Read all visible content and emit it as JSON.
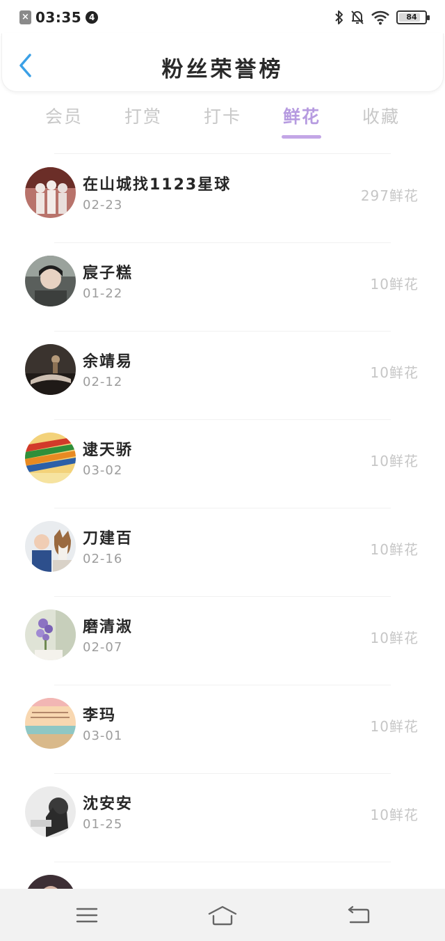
{
  "status_bar": {
    "time": "03:35",
    "notification_count": "4",
    "battery": "84",
    "battery_fraction": 0.84
  },
  "header": {
    "title": "粉丝荣誉榜"
  },
  "tabs": [
    {
      "label": "会员"
    },
    {
      "label": "打赏"
    },
    {
      "label": "打卡"
    },
    {
      "label": "鲜花"
    },
    {
      "label": "收藏"
    }
  ],
  "active_tab": "鲜花",
  "fans": [
    {
      "name": "在山城找1123星球",
      "date": "02-23",
      "count": "297鲜花"
    },
    {
      "name": "宸子糕",
      "date": "01-22",
      "count": "10鲜花"
    },
    {
      "name": "余靖易",
      "date": "02-12",
      "count": "10鲜花"
    },
    {
      "name": "逮天骄",
      "date": "03-02",
      "count": "10鲜花"
    },
    {
      "name": "刀建百",
      "date": "02-16",
      "count": "10鲜花"
    },
    {
      "name": "磨清淑",
      "date": "02-07",
      "count": "10鲜花"
    },
    {
      "name": "李玛",
      "date": "03-01",
      "count": "10鲜花"
    },
    {
      "name": "沈安安",
      "date": "01-25",
      "count": "10鲜花"
    }
  ],
  "colors": {
    "accent": "#b69be0",
    "back_arrow": "#3ba0e6"
  }
}
